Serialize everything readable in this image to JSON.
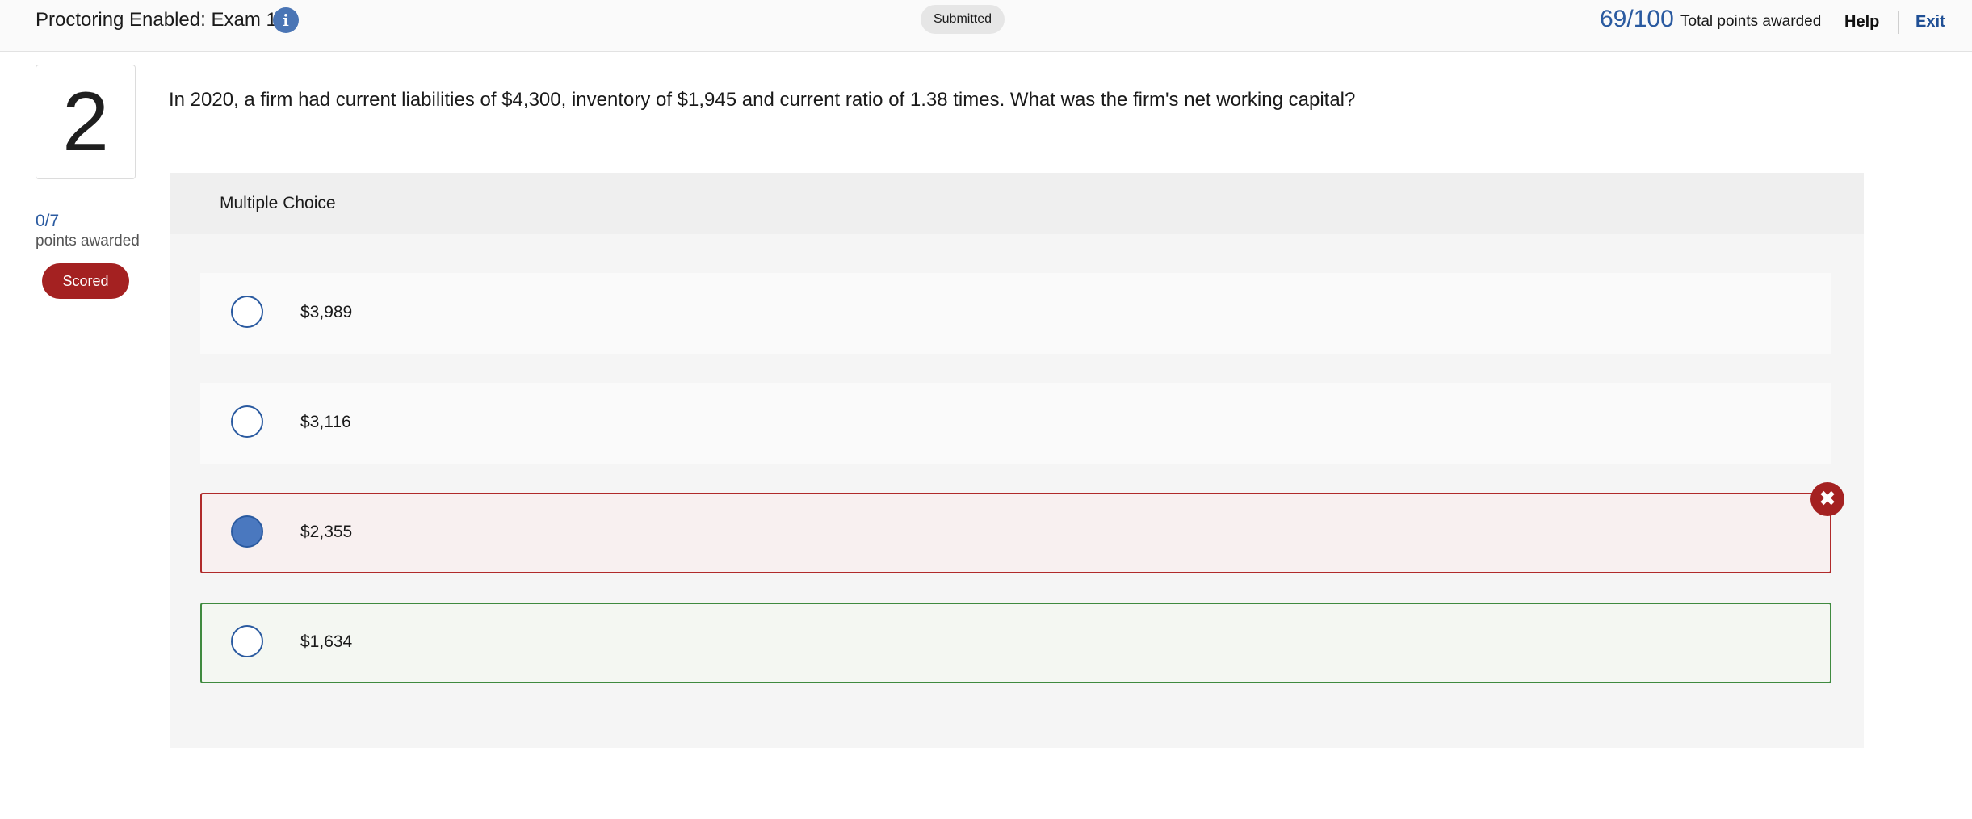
{
  "header": {
    "exam_title": "Proctoring Enabled: Exam 1",
    "info_icon": "info-icon",
    "status": "Submitted",
    "score": "69/100",
    "score_label": "Total points awarded",
    "help_label": "Help",
    "exit_label": "Exit",
    "accent_color": "#2a5aa0"
  },
  "question": {
    "number": "2",
    "points_value": "0/7",
    "points_label": "points awarded",
    "badge": "Scored",
    "badge_color": "#a42121",
    "text": "In 2020, a firm had current liabilities of $4,300, inventory of $1,945 and current ratio of 1.38 times. What was the firm's net working capital?",
    "type_label": "Multiple Choice",
    "options": [
      {
        "label": "$3,989",
        "selected": false,
        "status": "none"
      },
      {
        "label": "$3,116",
        "selected": false,
        "status": "none"
      },
      {
        "label": "$2,355",
        "selected": true,
        "status": "incorrect"
      },
      {
        "label": "$1,634",
        "selected": false,
        "status": "correct"
      }
    ],
    "incorrect_icon": "close-icon"
  }
}
